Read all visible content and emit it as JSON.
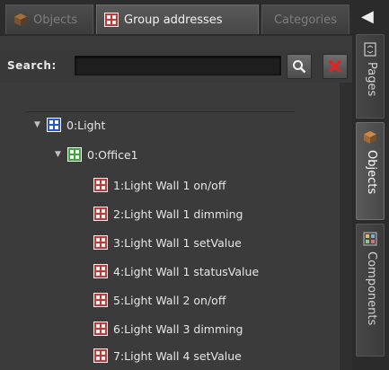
{
  "tabs": {
    "objects": "Objects",
    "group_addresses": "Group addresses",
    "categories": "Categories",
    "active": "group_addresses"
  },
  "search": {
    "label": "Search:",
    "value": "",
    "search_icon": "magnifier-icon",
    "clear_icon": "red-x-icon"
  },
  "tree": {
    "root": {
      "label": "0:Light",
      "expanded": true,
      "icon": "group-blue-icon"
    },
    "child": {
      "label": "0:Office1",
      "expanded": true,
      "icon": "group-green-icon"
    },
    "items": [
      "1:Light Wall 1 on/off",
      "2:Light Wall 1 dimming",
      "3:Light Wall 1 setValue",
      "4:Light Wall 1 statusValue",
      "5:Light Wall 2 on/off",
      "6:Light Wall 3 dimming",
      "7:Light Wall 4 setValue"
    ],
    "item_icon": "group-address-red-icon"
  },
  "sidebar": {
    "collapse_icon": "triangle-left-icon",
    "pages": "Pages",
    "objects": "Objects",
    "components": "Components",
    "active": "objects"
  },
  "colors": {
    "background": "#3b3b3b",
    "text": "#e6e6e6",
    "inactive_text": "#7d7d7d",
    "red_icon": "#d83030",
    "blue_icon": "#2a55d0",
    "green_icon": "#38a838"
  }
}
